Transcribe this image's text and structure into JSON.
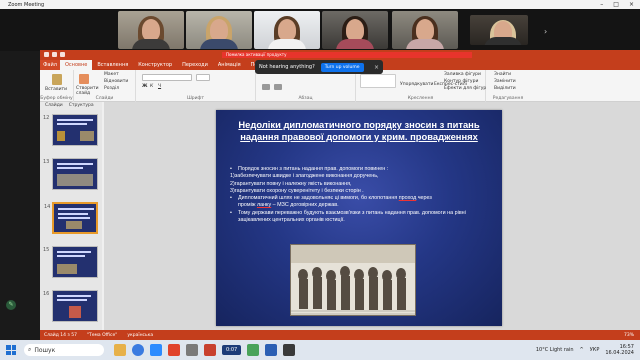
{
  "zoom": {
    "window_title": "Zoom Meeting",
    "toast_text": "Not hearing anything?",
    "toast_button": "Turn up volume",
    "toast_close": "×"
  },
  "ppt": {
    "warning_text": "Помилка активації продукту",
    "ribbon_tabs": [
      "Файл",
      "Основне",
      "Вставлення",
      "Конструктор",
      "Переходи",
      "Анімація",
      "Показ"
    ],
    "groups": {
      "clipboard": "Буфер обміну",
      "slides": "Слайди",
      "font": "Шрифт",
      "paragraph": "Абзац",
      "drawing": "Креслення",
      "editing": "Редагування"
    },
    "clipboard_paste": "Вставити",
    "slides_new": "Створити слайд",
    "slides_layout": "Макет",
    "slides_reset": "Відновити",
    "slides_section": "Розділ",
    "drawing_arrange": "Упорядкувати",
    "drawing_styles": "Експрес-стилі",
    "drawing_fill": "Заливка фігури",
    "drawing_outline": "Контур фігури",
    "drawing_effects": "Ефекти для фігур",
    "editing_find": "Знайти",
    "editing_replace": "Замінити",
    "editing_select": "Виділити",
    "panel_tab_slides": "Слайди",
    "panel_tab_outline": "Структура",
    "slide_numbers": [
      "12",
      "13",
      "14",
      "15",
      "16"
    ],
    "status_slide": "Слайд 14 з 57",
    "status_theme": "\"Тема Office\"",
    "status_lang": "українська",
    "status_zoom": "73%"
  },
  "slide": {
    "title": "Недоліки дипломатичного порядку зносин з питань надання правової допомоги у крим. провадженнях",
    "intro": "Порядок зносин з питань надання прав. допомоги повинен :",
    "items": [
      "1)забезпечувати швидке і злагоджене виконання доручень,",
      "2)гарантувати повну і належну якість виконання,",
      "3)гарантувати охорону суверенітету і безпеки сторін ."
    ],
    "p2_a": "Дипломатичний шлях не задовольняє ці вимоги,  бо клопотання ",
    "p2_link": "проход",
    "p2_b": " через",
    "p2_line2_a": "промiж ",
    "p2_line2_link": "ланку",
    "p2_line2_b": " – МЗС договірних держав.",
    "p3": "Тому держави переважно будують взаємозв'язки з питань надання прав. допомоги на рівні зацікавлених центральних органів юстиції."
  },
  "taskbar": {
    "search": "Пошук",
    "recording": "0:07",
    "weather": "10°C  Light rain",
    "lang": "УКР",
    "time": "16:57",
    "date": "16.04.2024"
  },
  "colors": {
    "ppt_accent": "#c43e1c",
    "slide_bg": "#243786",
    "zoom_button": "#0e72ed"
  }
}
